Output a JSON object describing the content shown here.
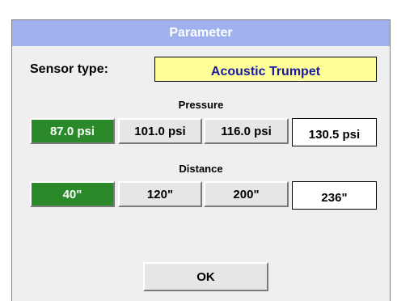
{
  "dialog": {
    "title": "Parameter"
  },
  "sensor": {
    "label": "Sensor type:",
    "value": "Acoustic Trumpet"
  },
  "pressure": {
    "label": "Pressure",
    "options": [
      "87.0 psi",
      "101.0 psi",
      "116.0 psi"
    ],
    "selected_index": 0,
    "custom_value": "130.5 psi"
  },
  "distance": {
    "label": "Distance",
    "options": [
      "40\"",
      "120\"",
      "200\""
    ],
    "selected_index": 0,
    "custom_value": "236\""
  },
  "ok_label": "OK",
  "colors": {
    "title_bar": "#9fb2ef",
    "selected": "#2a8a2a",
    "sensor_field": "#ffff99",
    "sensor_text": "#1a1aa0"
  }
}
